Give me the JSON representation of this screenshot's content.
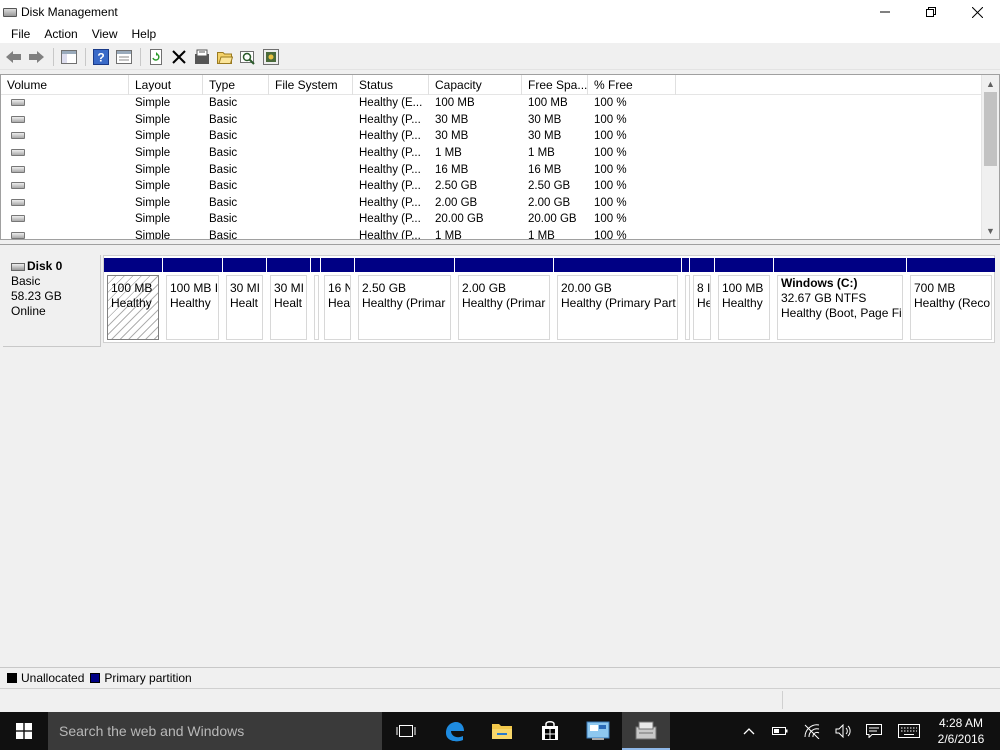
{
  "window": {
    "title": "Disk Management",
    "icon": "disk-management-icon",
    "controls": [
      "minimize-icon",
      "restore-icon",
      "close-icon"
    ]
  },
  "menu": [
    "File",
    "Action",
    "View",
    "Help"
  ],
  "toolbar": [
    "back-arrow-icon",
    "forward-arrow-icon",
    "console-tree-icon",
    "help-icon",
    "properties-icon",
    "refresh-icon",
    "delete-icon",
    "format-icon",
    "open-icon",
    "search-icon",
    "settings-icon"
  ],
  "volume_table": {
    "columns": [
      "Volume",
      "Layout",
      "Type",
      "File System",
      "Status",
      "Capacity",
      "Free Spa...",
      "% Free"
    ],
    "rows": [
      {
        "volume": "",
        "layout": "Simple",
        "type": "Basic",
        "fs": "",
        "status": "Healthy (E...",
        "capacity": "100 MB",
        "free": "100 MB",
        "pct": "100 %"
      },
      {
        "volume": "",
        "layout": "Simple",
        "type": "Basic",
        "fs": "",
        "status": "Healthy (P...",
        "capacity": "30 MB",
        "free": "30 MB",
        "pct": "100 %"
      },
      {
        "volume": "",
        "layout": "Simple",
        "type": "Basic",
        "fs": "",
        "status": "Healthy (P...",
        "capacity": "30 MB",
        "free": "30 MB",
        "pct": "100 %"
      },
      {
        "volume": "",
        "layout": "Simple",
        "type": "Basic",
        "fs": "",
        "status": "Healthy (P...",
        "capacity": "1 MB",
        "free": "1 MB",
        "pct": "100 %"
      },
      {
        "volume": "",
        "layout": "Simple",
        "type": "Basic",
        "fs": "",
        "status": "Healthy (P...",
        "capacity": "16 MB",
        "free": "16 MB",
        "pct": "100 %"
      },
      {
        "volume": "",
        "layout": "Simple",
        "type": "Basic",
        "fs": "",
        "status": "Healthy (P...",
        "capacity": "2.50 GB",
        "free": "2.50 GB",
        "pct": "100 %"
      },
      {
        "volume": "",
        "layout": "Simple",
        "type": "Basic",
        "fs": "",
        "status": "Healthy (P...",
        "capacity": "2.00 GB",
        "free": "2.00 GB",
        "pct": "100 %"
      },
      {
        "volume": "",
        "layout": "Simple",
        "type": "Basic",
        "fs": "",
        "status": "Healthy (P...",
        "capacity": "20.00 GB",
        "free": "20.00 GB",
        "pct": "100 %"
      },
      {
        "volume": "",
        "layout": "Simple",
        "type": "Basic",
        "fs": "",
        "status": "Healthy (P...",
        "capacity": "1 MB",
        "free": "1 MB",
        "pct": "100 %"
      }
    ]
  },
  "disk": {
    "name": "Disk 0",
    "type": "Basic",
    "size": "58.23 GB",
    "state": "Online",
    "partitions": [
      {
        "name": "",
        "size": "100 MB",
        "status": "Healthy",
        "selected": true
      },
      {
        "name": "",
        "size": "100 MB I",
        "status": "Healthy"
      },
      {
        "name": "",
        "size": "30 MI",
        "status": "Healt"
      },
      {
        "name": "",
        "size": "30 MI",
        "status": "Healt"
      },
      {
        "name": "",
        "size": "",
        "status": ""
      },
      {
        "name": "",
        "size": "16 N",
        "status": "Hea"
      },
      {
        "name": "",
        "size": "2.50 GB",
        "status": "Healthy (Primar"
      },
      {
        "name": "",
        "size": "2.00 GB",
        "status": "Healthy (Primar"
      },
      {
        "name": "",
        "size": "20.00 GB",
        "status": "Healthy (Primary Part"
      },
      {
        "name": "",
        "size": "",
        "status": ""
      },
      {
        "name": "",
        "size": "8 I",
        "status": "He"
      },
      {
        "name": "",
        "size": "100 MB",
        "status": "Healthy"
      },
      {
        "name": "Windows  (C:)",
        "size": "32.67 GB NTFS",
        "status": "Healthy (Boot, Page Fil"
      },
      {
        "name": "",
        "size": "700 MB",
        "status": "Healthy (Reco"
      }
    ]
  },
  "legend": [
    {
      "label": "Unallocated",
      "color": "#000000"
    },
    {
      "label": "Primary partition",
      "color": "#000084"
    }
  ],
  "taskbar": {
    "search_placeholder": "Search the web and Windows",
    "apps": [
      "task-view-icon",
      "edge-icon",
      "file-explorer-icon",
      "store-icon",
      "control-panel-icon",
      "disk-management-icon"
    ],
    "tray": [
      "chevron-up-icon",
      "battery-icon",
      "wifi-icon",
      "volume-icon",
      "notification-icon",
      "keyboard-icon"
    ],
    "time": "4:28 AM",
    "date": "2/6/2016"
  }
}
